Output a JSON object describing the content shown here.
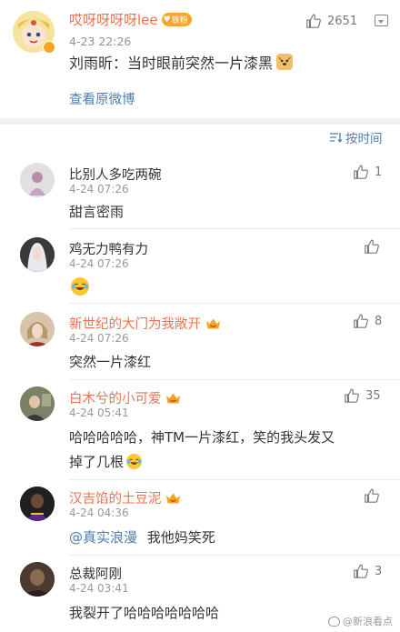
{
  "post": {
    "username": "哎呀呀呀呀lee",
    "fan_badge": "铁粉",
    "time": "4-23 22:26",
    "text": "刘雨昕：当时眼前突然一片漆黑",
    "like_count": "2651",
    "view_original": "查看原微博"
  },
  "sort": {
    "label": "按时间"
  },
  "comments": [
    {
      "name": "比别人多吃两碗",
      "name_color": "#333333",
      "vip": false,
      "time": "4-24 07:26",
      "text": "甜言密雨",
      "likes": "1"
    },
    {
      "name": "鸡无力鸭有力",
      "name_color": "#333333",
      "vip": false,
      "time": "4-24 07:26",
      "text": "",
      "emoji": "laughing-crying-emoji",
      "likes": ""
    },
    {
      "name": "新世纪的大门为我敞开",
      "name_color": "#eb7350",
      "vip": true,
      "time": "4-24 07:26",
      "text": "突然一片漆红",
      "likes": "8"
    },
    {
      "name": "白木兮的小可爱",
      "name_color": "#eb7350",
      "vip": true,
      "time": "4-24 05:41",
      "text_line1": "哈哈哈哈哈，神TM一片漆红，笑的我头发又",
      "text_line2": "掉了几根",
      "likes": "35"
    },
    {
      "name": "汉吉馅的土豆泥",
      "name_color": "#eb7350",
      "vip": true,
      "time": "4-24 04:36",
      "mention": "@真实浪漫",
      "text": "我他妈笑死",
      "likes": ""
    },
    {
      "name": "总裁阿刚",
      "name_color": "#333333",
      "vip": false,
      "time": "4-24 03:41",
      "text": "我裂开了哈哈哈哈哈哈哈",
      "likes": "3"
    }
  ],
  "watermark": "@新浪看点",
  "colors": {
    "accent": "#eb7350",
    "link": "#507daf",
    "gold": "#f5a623"
  }
}
